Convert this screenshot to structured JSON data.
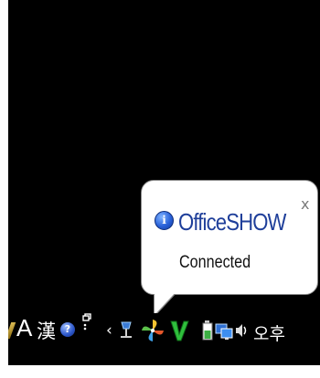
{
  "balloon": {
    "title": "OfficeSHOW",
    "message": "Connected",
    "close_label": "x",
    "info_icon": "i"
  },
  "taskbar": {
    "ime_mode": "A",
    "ime_hanja": "漢",
    "help_glyph": "?",
    "options_glyph": "ᴾ",
    "expand_glyph": "‹",
    "clock_text": "오후"
  },
  "colors": {
    "balloon_title": "#1f3f9a",
    "screen_background": "#000000",
    "balloon_background": "#ffffff"
  },
  "icons": [
    "pen-icon",
    "help-icon",
    "taskbar-options-icon",
    "show-hidden-icons-chevron-icon",
    "network-icon",
    "pinwheel-app-icon",
    "v3-antivirus-icon",
    "battery-icon",
    "network-monitor-icon",
    "volume-icon"
  ]
}
